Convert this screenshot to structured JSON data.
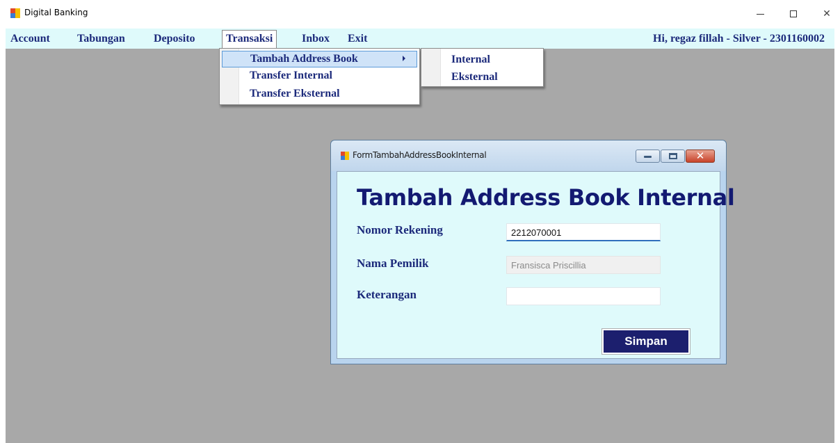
{
  "window": {
    "title": "Digital Banking"
  },
  "menu": {
    "items": [
      {
        "label": "Account"
      },
      {
        "label": "Tabungan"
      },
      {
        "label": "Deposito"
      },
      {
        "label": "Transaksi"
      },
      {
        "label": "Inbox"
      },
      {
        "label": "Exit"
      }
    ],
    "greeting": "Hi, regaz fillah - Silver - 2301160002"
  },
  "transaksi_menu": {
    "items": [
      {
        "label": "Tambah Address Book",
        "has_submenu": true,
        "highlighted": true
      },
      {
        "label": "Transfer Internal"
      },
      {
        "label": "Transfer Eksternal"
      }
    ]
  },
  "address_book_submenu": {
    "items": [
      {
        "label": "Internal"
      },
      {
        "label": "Eksternal"
      }
    ]
  },
  "child_form": {
    "caption": "FormTambahAddressBookInternal",
    "heading": "Tambah Address Book Internal",
    "fields": {
      "nomor_rekening": {
        "label": "Nomor Rekening",
        "value": "2212070001"
      },
      "nama_pemilik": {
        "label": "Nama Pemilik",
        "value": "Fransisca Priscillia",
        "disabled": true
      },
      "keterangan": {
        "label": "Keterangan",
        "value": ""
      }
    },
    "save_label": "Simpan"
  },
  "colors": {
    "menu_background": "#dffafb",
    "menu_text": "#1c2a7b",
    "mdi_background": "#a8a8a8",
    "heading": "#131a72",
    "save_button": "#1c1f6e"
  }
}
